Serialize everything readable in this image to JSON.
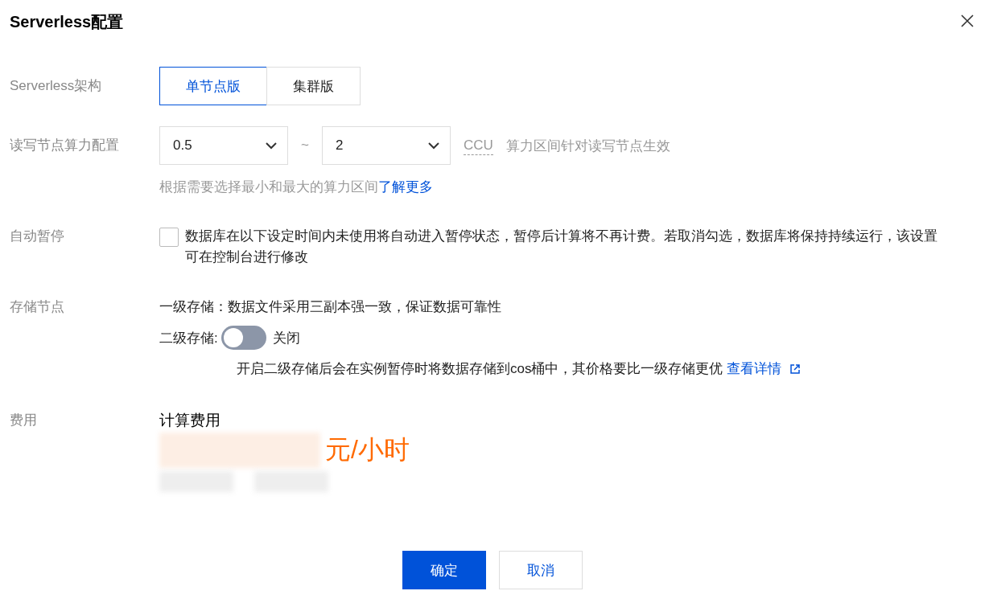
{
  "dialog": {
    "title": "Serverless配置"
  },
  "architecture": {
    "label": "Serverless架构",
    "options": [
      {
        "label": "单节点版",
        "selected": true
      },
      {
        "label": "集群版",
        "selected": false
      }
    ]
  },
  "compute": {
    "label": "读写节点算力配置",
    "min": "0.5",
    "separator": "~",
    "max": "2",
    "unit": "CCU",
    "note": "算力区间针对读写节点生效",
    "hint": "根据需要选择最小和最大的算力区间",
    "hint_link": "了解更多"
  },
  "auto_pause": {
    "label": "自动暂停",
    "checked": false,
    "text": "数据库在以下设定时间内未使用将自动进入暂停状态，暂停后计算将不再计费。若取消勾选，数据库将保持持续运行，该设置可在控制台进行修改"
  },
  "storage": {
    "label": "存储节点",
    "tier1": "一级存储：数据文件采用三副本强一致，保证数据可靠性",
    "tier2_label": "二级存储:",
    "tier2_on": false,
    "tier2_state": "关闭",
    "tier2_note": "开启二级存储后会在实例暂停时将数据存储到cos桶中，其价格要比一级存储更优",
    "tier2_link": "查看详情"
  },
  "fee": {
    "label": "费用",
    "title": "计算费用",
    "unit": "元/小时"
  },
  "buttons": [
    {
      "label": "确定",
      "kind": "primary"
    },
    {
      "label": "取消",
      "kind": "secondary"
    }
  ]
}
